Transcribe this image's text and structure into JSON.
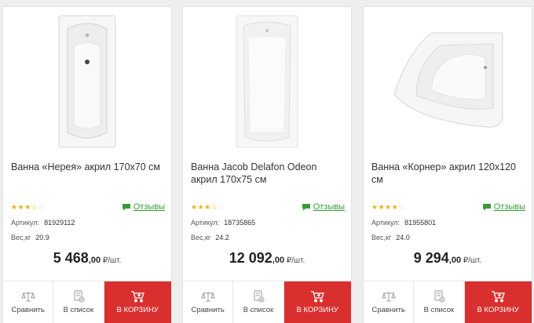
{
  "products": [
    {
      "title": "Ванна «Нерея» акрил 170х70 см",
      "rating": 3.5,
      "reviews_label": "Отзывы",
      "article_label": "Артикул:",
      "article": "81929112",
      "weight_label": "Вес,кг",
      "weight": "20.9",
      "price_main": "5 468",
      "price_cents": ",00",
      "price_unit": " ₽/шт.",
      "compare_label": "Сравнить",
      "list_label": "В список",
      "cart_label": "В КОРЗИНУ"
    },
    {
      "title": "Ванна Jacob Delafon Odeon акрил 170х75 см",
      "rating": 3.5,
      "reviews_label": "Отзывы",
      "article_label": "Артикул:",
      "article": "18735865",
      "weight_label": "Вес,кг",
      "weight": "24.2",
      "price_main": "12 092",
      "price_cents": ",00",
      "price_unit": " ₽/шт.",
      "compare_label": "Сравнить",
      "list_label": "В список",
      "cart_label": "В КОРЗИНУ"
    },
    {
      "title": "Ванна «Корнер» акрил 120х120 см",
      "rating": 4,
      "reviews_label": "Отзывы",
      "article_label": "Артикул:",
      "article": "81955801",
      "weight_label": "Вес,кг",
      "weight": "24.0",
      "price_main": "9 294",
      "price_cents": ",00",
      "price_unit": " ₽/шт.",
      "compare_label": "Сравнить",
      "list_label": "В список",
      "cart_label": "В КОРЗИНУ"
    }
  ],
  "colors": {
    "accent": "#d9302f",
    "reviews": "#3a9a3a",
    "stars": "#e6b21a"
  }
}
